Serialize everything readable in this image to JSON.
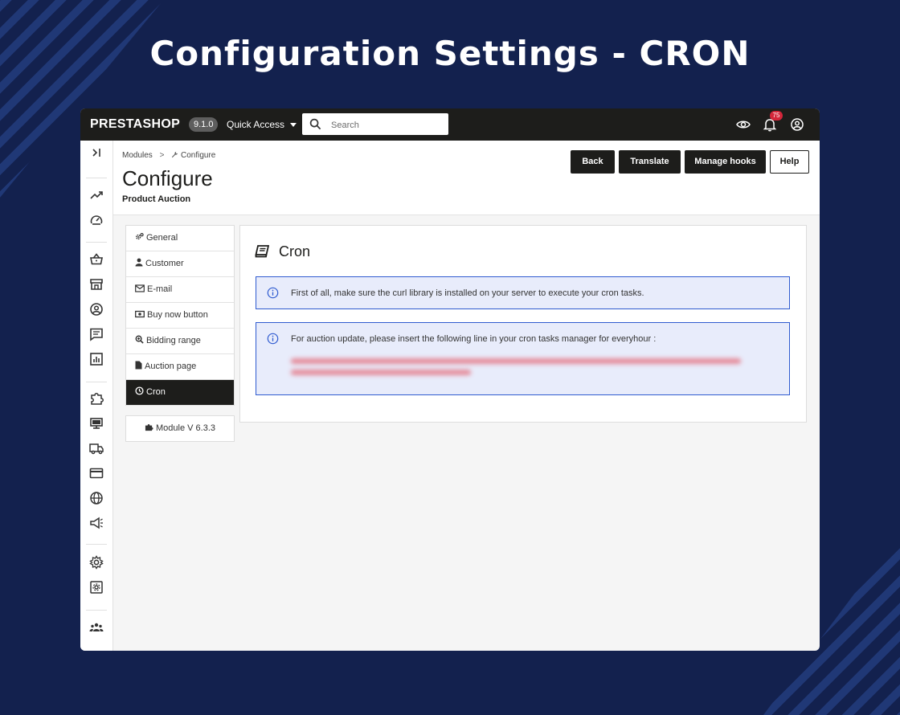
{
  "banner": {
    "title": "Configuration Settings - CRON"
  },
  "topbar": {
    "logo": "PRESTASHOP",
    "version": "9.1.0",
    "quick_access": "Quick Access",
    "search_placeholder": "Search",
    "notification_count": "75"
  },
  "breadcrumb": {
    "parent": "Modules",
    "separator": ">",
    "current": "Configure"
  },
  "header": {
    "title": "Configure",
    "subtitle": "Product Auction",
    "buttons": {
      "back": "Back",
      "translate": "Translate",
      "manage_hooks": "Manage hooks",
      "help": "Help"
    }
  },
  "tabs": [
    {
      "label": "General",
      "icon": "cogs-icon"
    },
    {
      "label": "Customer",
      "icon": "user-icon"
    },
    {
      "label": "E-mail",
      "icon": "envelope-icon"
    },
    {
      "label": "Buy now button",
      "icon": "money-icon"
    },
    {
      "label": "Bidding range",
      "icon": "search-plus-icon"
    },
    {
      "label": "Auction page",
      "icon": "file-icon"
    },
    {
      "label": "Cron",
      "icon": "clock-icon",
      "active": true
    }
  ],
  "module_version": "Module V 6.3.3",
  "panel": {
    "title": "Cron",
    "alerts": [
      "First of all, make sure the curl library is installed on your server to execute your cron tasks.",
      "For auction update, please insert the following line in your cron tasks manager for everyhour :"
    ]
  },
  "colors": {
    "background": "#13214e",
    "topbar": "#1d1d1b",
    "alert_border": "#2f5bd0",
    "alert_bg": "#e8ecfb",
    "badge": "#d3263a"
  }
}
